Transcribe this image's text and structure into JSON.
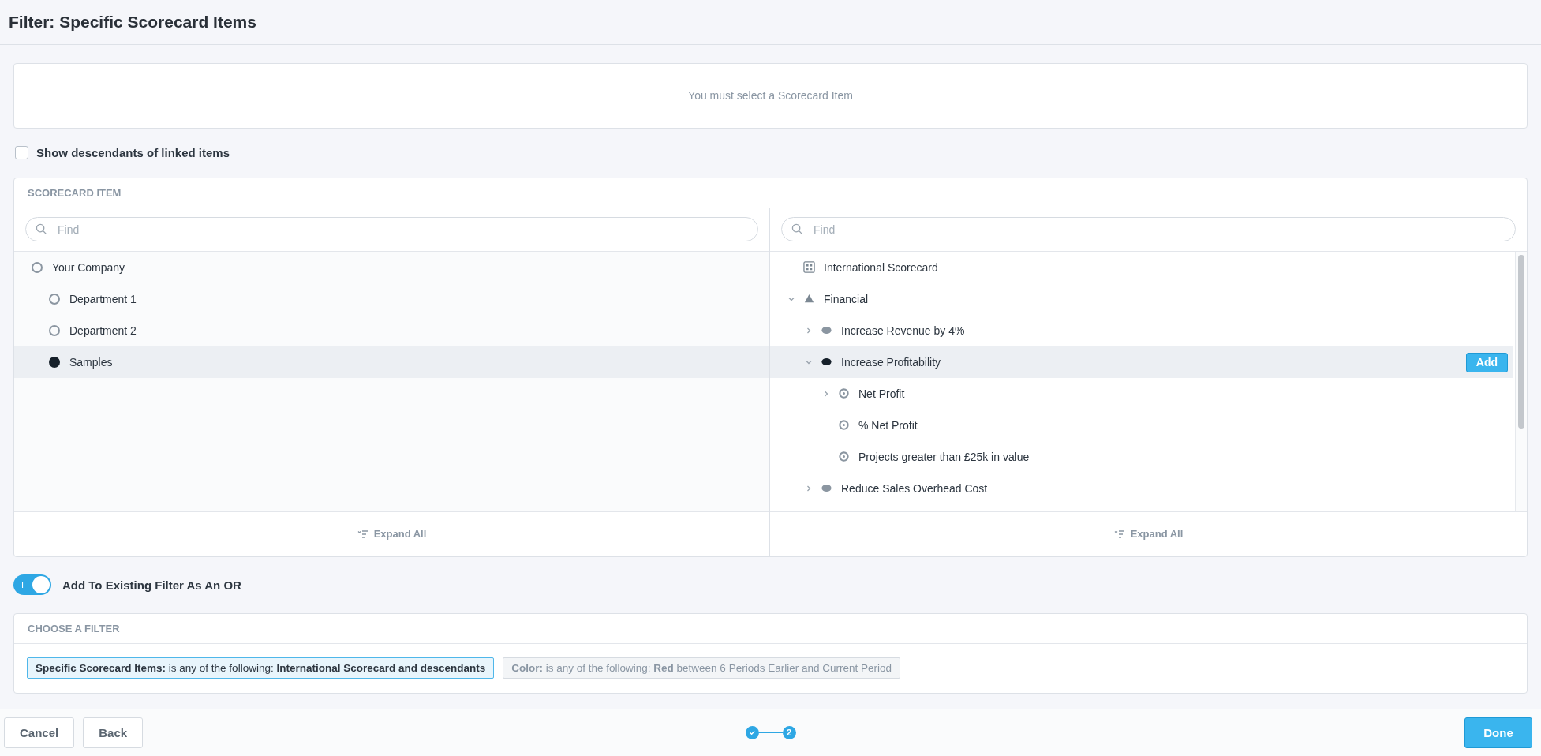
{
  "title": "Filter: Specific Scorecard Items",
  "message": "You must select a Scorecard Item",
  "descendants_option": {
    "label": "Show descendants of linked items",
    "checked": false
  },
  "scorecard_panel": {
    "heading": "SCORECARD ITEM",
    "left": {
      "search": {
        "placeholder": "Find"
      },
      "expand_all": "Expand All",
      "tree": [
        {
          "label": "Your Company",
          "selected": false,
          "children": [
            {
              "label": "Department 1",
              "selected": false
            },
            {
              "label": "Department 2",
              "selected": false
            },
            {
              "label": "Samples",
              "selected": true
            }
          ]
        }
      ]
    },
    "right": {
      "search": {
        "placeholder": "Find"
      },
      "expand_all": "Expand All",
      "tree": [
        {
          "label": "International Scorecard",
          "kind": "scorecard",
          "selected": false
        },
        {
          "label": "Financial",
          "kind": "perspective",
          "expanded": true,
          "selected": false,
          "children": [
            {
              "label": "Increase Revenue by 4%",
              "kind": "objective",
              "expanded": false,
              "selected": false
            },
            {
              "label": "Increase Profitability",
              "kind": "objective",
              "expanded": true,
              "selected": true,
              "action": "Add",
              "children": [
                {
                  "label": "Net Profit",
                  "kind": "measure",
                  "expanded": false,
                  "selected": false
                },
                {
                  "label": "% Net Profit",
                  "kind": "measure",
                  "selected": false
                },
                {
                  "label": "Projects greater than £25k in value",
                  "kind": "measure",
                  "selected": false
                }
              ]
            },
            {
              "label": "Reduce Sales Overhead Cost",
              "kind": "objective",
              "expanded": false,
              "selected": false
            }
          ]
        }
      ]
    }
  },
  "or_toggle": {
    "label": "Add To Existing Filter As An OR",
    "on": true,
    "knob_text": "I"
  },
  "filter_panel": {
    "heading": "CHOOSE A FILTER",
    "filters": [
      {
        "text": "**Specific Scorecard Items:** is any of the following: **International Scorecard and descendants**",
        "selected": true
      },
      {
        "text": "**Color:** is any of the following: **Red** between 6 Periods Earlier and Current Period",
        "selected": false
      }
    ]
  },
  "footer": {
    "buttons": [
      "Cancel",
      "Back"
    ],
    "steps": [
      {
        "done": true
      },
      {
        "done": false,
        "label": "2"
      }
    ],
    "done_button": "Done"
  }
}
